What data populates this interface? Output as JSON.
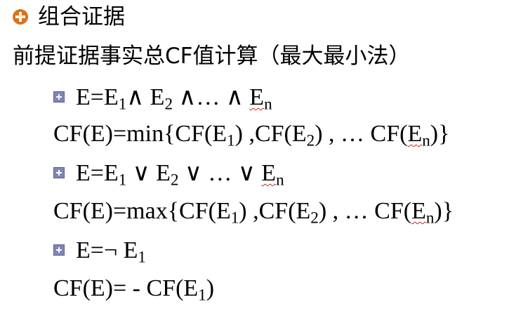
{
  "heading": {
    "title": "组合证据"
  },
  "subheading": {
    "text": "前提证据事实总CF值计算（最大最小法）"
  },
  "items": [
    {
      "expr_prefix": "E=E",
      "sub1": "1",
      "mid1": "∧ E",
      "sub2": "2",
      "mid2": " ∧… ∧ ",
      "tail_base": "E",
      "tail_sub": "n"
    },
    {
      "prefix": "CF(E)=min{CF(E",
      "sub1": "1",
      "mid1": ") ,CF(E",
      "sub2": "2",
      "mid2": ") , … CF(",
      "tail_base": "E",
      "tail_sub": "n",
      "close": ")}"
    },
    {
      "expr_prefix": "E=E",
      "sub1": "1",
      "mid1": " ∨ E",
      "sub2": "2",
      "mid2": " ∨ … ∨ ",
      "tail_base": "E",
      "tail_sub": "n"
    },
    {
      "prefix": "CF(E)=max{CF(E",
      "sub1": "1",
      "mid1": ") ,CF(E",
      "sub2": "2",
      "mid2": ") , … CF(",
      "tail_base": "E",
      "tail_sub": "n",
      "close": ")}"
    },
    {
      "expr_prefix": "E=¬ E",
      "sub1": "1"
    },
    {
      "prefix": "CF(E)= - CF(E",
      "sub1": "1",
      "close": ")"
    }
  ]
}
